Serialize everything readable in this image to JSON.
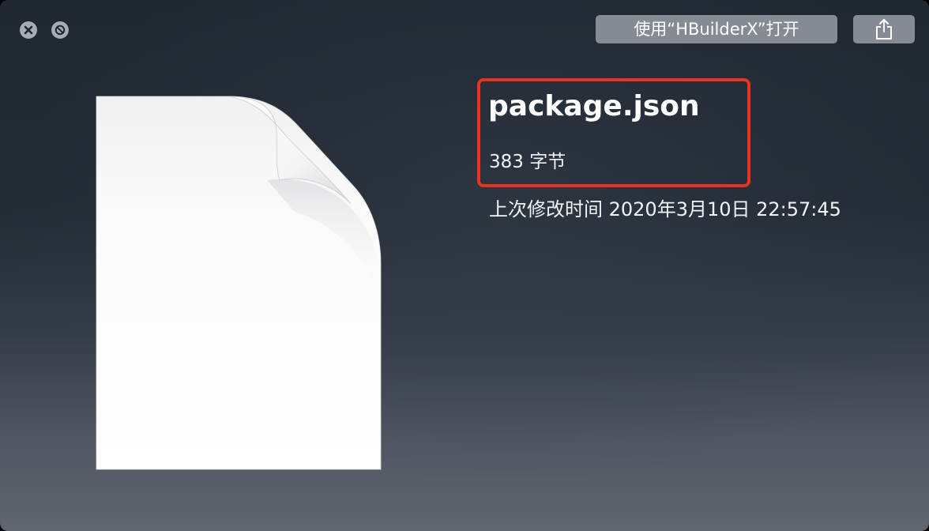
{
  "window": {
    "close_icon": "close-circle-icon",
    "fullscreen_icon": "fullscreen-circle-icon"
  },
  "toolbar": {
    "open_with_label": "使用“HBuilderX”打开",
    "share_icon": "share-icon"
  },
  "preview": {
    "icon": "generic-document-icon"
  },
  "file": {
    "name": "package.json",
    "size": "383 字节",
    "modified": "上次修改时间 2020年3月10日 22:57:45"
  },
  "annotation": {
    "color": "#e8331f"
  },
  "colors": {
    "button_bg": "#868b93",
    "window_bg_top": "#1f2731",
    "window_bg_bottom": "#60666f"
  }
}
